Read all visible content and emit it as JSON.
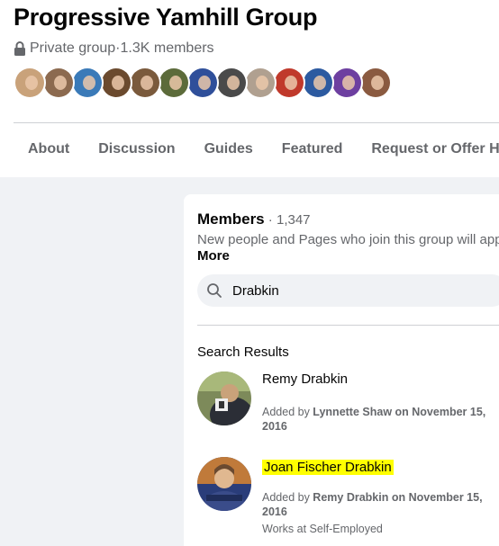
{
  "group": {
    "name": "Progressive Yamhill Group",
    "privacy": "Private group",
    "separator": " · ",
    "members_short": "1.3K members",
    "privacy_icon": "lock-icon"
  },
  "member_avatars": [
    {
      "color": "#c9a27a"
    },
    {
      "color": "#8c6a4f"
    },
    {
      "color": "#3a7ab8"
    },
    {
      "color": "#6b4a2e"
    },
    {
      "color": "#7a5a3c"
    },
    {
      "color": "#5c6b3a"
    },
    {
      "color": "#2f4f9a"
    },
    {
      "color": "#4a4a4a"
    },
    {
      "color": "#b0a090"
    },
    {
      "color": "#c0392b"
    },
    {
      "color": "#2c5aa0"
    },
    {
      "color": "#6d3fa0"
    },
    {
      "color": "#8a5a40"
    }
  ],
  "tabs": [
    {
      "label": "About"
    },
    {
      "label": "Discussion"
    },
    {
      "label": "Guides"
    },
    {
      "label": "Featured"
    },
    {
      "label": "Request or Offer Help"
    }
  ],
  "members_panel": {
    "title": "Members",
    "count": " · 1,347",
    "description": "New people and Pages who join this group will app",
    "more_label": "More",
    "search_value": "Drabkin",
    "search_icon": "search-icon",
    "results_heading": "Search Results"
  },
  "results": [
    {
      "name": "Remy Drabkin",
      "added_prefix": "Added by ",
      "added_by": "Lynnette Shaw",
      "added_suffix": " on November 15, 2016",
      "work": ""
    },
    {
      "name": "Joan Fischer Drabkin",
      "added_prefix": "Added by ",
      "added_by": "Remy Drabkin",
      "added_suffix": " on November 15, 2016",
      "work": "Works at Self-Employed"
    }
  ],
  "colors": {
    "highlight": "#ffff00",
    "secondary_text": "#65676b",
    "background": "#f0f2f5"
  }
}
